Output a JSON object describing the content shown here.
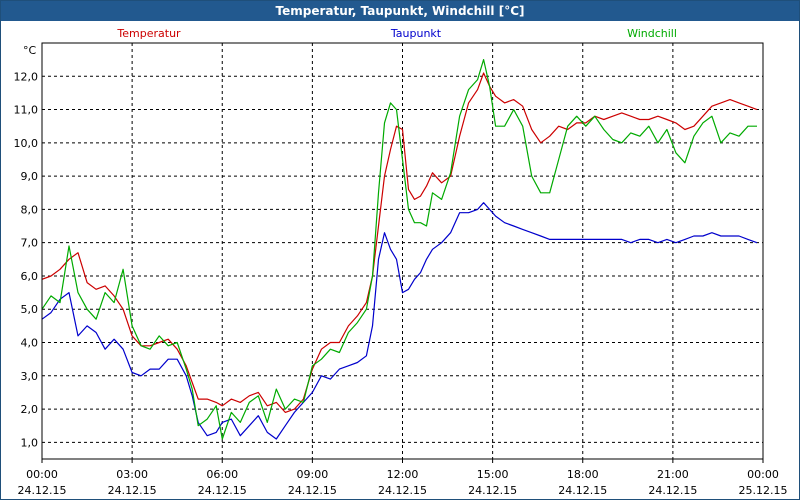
{
  "window": {
    "title": "Temperatur, Taupunkt, Windchill [°C]"
  },
  "chart_data": {
    "type": "line",
    "title": "Temperatur, Taupunkt, Windchill [°C]",
    "ylabel": "°C",
    "ylim": [
      0.5,
      13.0
    ],
    "yticks": [
      1.0,
      2.0,
      3.0,
      4.0,
      5.0,
      6.0,
      7.0,
      8.0,
      9.0,
      10.0,
      11.0,
      12.0
    ],
    "ytick_labels": [
      "1,0",
      "2,0",
      "3,0",
      "4,0",
      "5,0",
      "6,0",
      "7,0",
      "8,0",
      "9,0",
      "10,0",
      "11,0",
      "12,0"
    ],
    "xlim": [
      0,
      24
    ],
    "xticks": [
      0,
      3,
      6,
      9,
      12,
      15,
      18,
      21,
      24
    ],
    "xtick_labels": [
      [
        "00:00",
        "24.12.15"
      ],
      [
        "03:00",
        "24.12.15"
      ],
      [
        "06:00",
        "24.12.15"
      ],
      [
        "09:00",
        "24.12.15"
      ],
      [
        "12:00",
        "24.12.15"
      ],
      [
        "15:00",
        "24.12.15"
      ],
      [
        "18:00",
        "24.12.15"
      ],
      [
        "21:00",
        "24.12.15"
      ],
      [
        "00:00",
        "25.12.15"
      ]
    ],
    "grid": true,
    "series": [
      {
        "name": "Temperatur",
        "color": "#cc0000",
        "x": [
          0,
          0.3,
          0.6,
          0.9,
          1.2,
          1.5,
          1.8,
          2.1,
          2.4,
          2.7,
          3.0,
          3.3,
          3.6,
          3.9,
          4.2,
          4.5,
          4.8,
          5.0,
          5.2,
          5.5,
          5.8,
          6.0,
          6.3,
          6.6,
          6.9,
          7.2,
          7.5,
          7.8,
          8.1,
          8.4,
          8.7,
          9.0,
          9.3,
          9.6,
          9.9,
          10.2,
          10.5,
          10.8,
          11.0,
          11.2,
          11.4,
          11.6,
          11.8,
          12.0,
          12.2,
          12.4,
          12.6,
          12.8,
          13.0,
          13.3,
          13.6,
          13.9,
          14.2,
          14.5,
          14.7,
          14.9,
          15.1,
          15.4,
          15.7,
          16.0,
          16.3,
          16.6,
          16.9,
          17.2,
          17.5,
          17.8,
          18.1,
          18.4,
          18.7,
          19.0,
          19.3,
          19.6,
          19.9,
          20.2,
          20.5,
          20.8,
          21.1,
          21.4,
          21.7,
          22.0,
          22.3,
          22.6,
          22.9,
          23.2,
          23.5,
          23.8
        ],
        "y": [
          5.9,
          6.0,
          6.2,
          6.5,
          6.7,
          5.8,
          5.6,
          5.7,
          5.4,
          5.0,
          4.2,
          3.9,
          3.9,
          4.0,
          4.1,
          3.8,
          3.3,
          2.8,
          2.3,
          2.3,
          2.2,
          2.1,
          2.3,
          2.2,
          2.4,
          2.5,
          2.1,
          2.2,
          1.9,
          2.0,
          2.3,
          3.2,
          3.8,
          4.0,
          4.0,
          4.5,
          4.8,
          5.2,
          6.0,
          7.5,
          9.0,
          9.8,
          10.5,
          10.4,
          8.6,
          8.3,
          8.4,
          8.7,
          9.1,
          8.8,
          9.0,
          10.2,
          11.2,
          11.6,
          12.1,
          11.7,
          11.4,
          11.2,
          11.3,
          11.1,
          10.4,
          10.0,
          10.2,
          10.5,
          10.4,
          10.6,
          10.6,
          10.8,
          10.7,
          10.8,
          10.9,
          10.8,
          10.7,
          10.7,
          10.8,
          10.7,
          10.6,
          10.4,
          10.5,
          10.8,
          11.1,
          11.2,
          11.3,
          11.2,
          11.1,
          11.0
        ]
      },
      {
        "name": "Taupunkt",
        "color": "#0000cc",
        "x": [
          0,
          0.3,
          0.6,
          0.9,
          1.2,
          1.5,
          1.8,
          2.1,
          2.4,
          2.7,
          3.0,
          3.3,
          3.6,
          3.9,
          4.2,
          4.5,
          4.8,
          5.0,
          5.2,
          5.5,
          5.8,
          6.0,
          6.3,
          6.6,
          6.9,
          7.2,
          7.5,
          7.8,
          8.1,
          8.4,
          8.7,
          9.0,
          9.3,
          9.6,
          9.9,
          10.2,
          10.5,
          10.8,
          11.0,
          11.2,
          11.4,
          11.6,
          11.8,
          12.0,
          12.2,
          12.4,
          12.6,
          12.8,
          13.0,
          13.3,
          13.6,
          13.9,
          14.2,
          14.5,
          14.7,
          14.9,
          15.1,
          15.4,
          15.7,
          16.0,
          16.3,
          16.6,
          16.9,
          17.2,
          17.5,
          17.8,
          18.1,
          18.4,
          18.7,
          19.0,
          19.3,
          19.6,
          19.9,
          20.2,
          20.5,
          20.8,
          21.1,
          21.4,
          21.7,
          22.0,
          22.3,
          22.6,
          22.9,
          23.2,
          23.5,
          23.8
        ],
        "y": [
          4.7,
          4.9,
          5.3,
          5.5,
          4.2,
          4.5,
          4.3,
          3.8,
          4.1,
          3.8,
          3.1,
          3.0,
          3.2,
          3.2,
          3.5,
          3.5,
          3.0,
          2.4,
          1.6,
          1.2,
          1.3,
          1.6,
          1.7,
          1.2,
          1.5,
          1.8,
          1.3,
          1.1,
          1.5,
          1.9,
          2.2,
          2.5,
          3.0,
          2.9,
          3.2,
          3.3,
          3.4,
          3.6,
          4.5,
          6.5,
          7.3,
          6.8,
          6.5,
          5.5,
          5.6,
          5.9,
          6.1,
          6.5,
          6.8,
          7.0,
          7.3,
          7.9,
          7.9,
          8.0,
          8.2,
          8.0,
          7.8,
          7.6,
          7.5,
          7.4,
          7.3,
          7.2,
          7.1,
          7.1,
          7.1,
          7.1,
          7.1,
          7.1,
          7.1,
          7.1,
          7.1,
          7.0,
          7.1,
          7.1,
          7.0,
          7.1,
          7.0,
          7.1,
          7.2,
          7.2,
          7.3,
          7.2,
          7.2,
          7.2,
          7.1,
          7.0
        ]
      },
      {
        "name": "Windchill",
        "color": "#00aa00",
        "x": [
          0,
          0.3,
          0.6,
          0.9,
          1.2,
          1.5,
          1.8,
          2.1,
          2.4,
          2.7,
          3.0,
          3.3,
          3.6,
          3.9,
          4.2,
          4.5,
          4.8,
          5.0,
          5.2,
          5.5,
          5.8,
          6.0,
          6.3,
          6.6,
          6.9,
          7.2,
          7.5,
          7.8,
          8.1,
          8.4,
          8.7,
          9.0,
          9.3,
          9.6,
          9.9,
          10.2,
          10.5,
          10.8,
          11.0,
          11.2,
          11.4,
          11.6,
          11.8,
          12.0,
          12.2,
          12.4,
          12.6,
          12.8,
          13.0,
          13.3,
          13.6,
          13.9,
          14.2,
          14.5,
          14.7,
          14.9,
          15.1,
          15.4,
          15.7,
          16.0,
          16.3,
          16.6,
          16.9,
          17.2,
          17.5,
          17.8,
          18.1,
          18.4,
          18.7,
          19.0,
          19.3,
          19.6,
          19.9,
          20.2,
          20.5,
          20.8,
          21.1,
          21.4,
          21.7,
          22.0,
          22.3,
          22.6,
          22.9,
          23.2,
          23.5,
          23.8
        ],
        "y": [
          5.0,
          5.4,
          5.2,
          6.9,
          5.5,
          5.0,
          4.7,
          5.5,
          5.2,
          6.2,
          4.5,
          3.9,
          3.8,
          4.2,
          3.9,
          4.0,
          3.2,
          2.6,
          1.5,
          1.7,
          2.1,
          1.1,
          1.9,
          1.6,
          2.2,
          2.4,
          1.6,
          2.6,
          2.0,
          2.3,
          2.2,
          3.3,
          3.5,
          3.8,
          3.7,
          4.3,
          4.6,
          5.0,
          6.0,
          8.5,
          10.6,
          11.2,
          11.0,
          9.5,
          8.0,
          7.6,
          7.6,
          7.5,
          8.5,
          8.3,
          9.1,
          10.8,
          11.6,
          11.9,
          12.5,
          11.7,
          10.5,
          10.5,
          11.0,
          10.5,
          9.0,
          8.5,
          8.5,
          9.5,
          10.5,
          10.8,
          10.5,
          10.8,
          10.4,
          10.1,
          10.0,
          10.3,
          10.2,
          10.5,
          10.0,
          10.4,
          9.7,
          9.4,
          10.2,
          10.6,
          10.8,
          10.0,
          10.3,
          10.2,
          10.5,
          10.5
        ]
      }
    ]
  }
}
